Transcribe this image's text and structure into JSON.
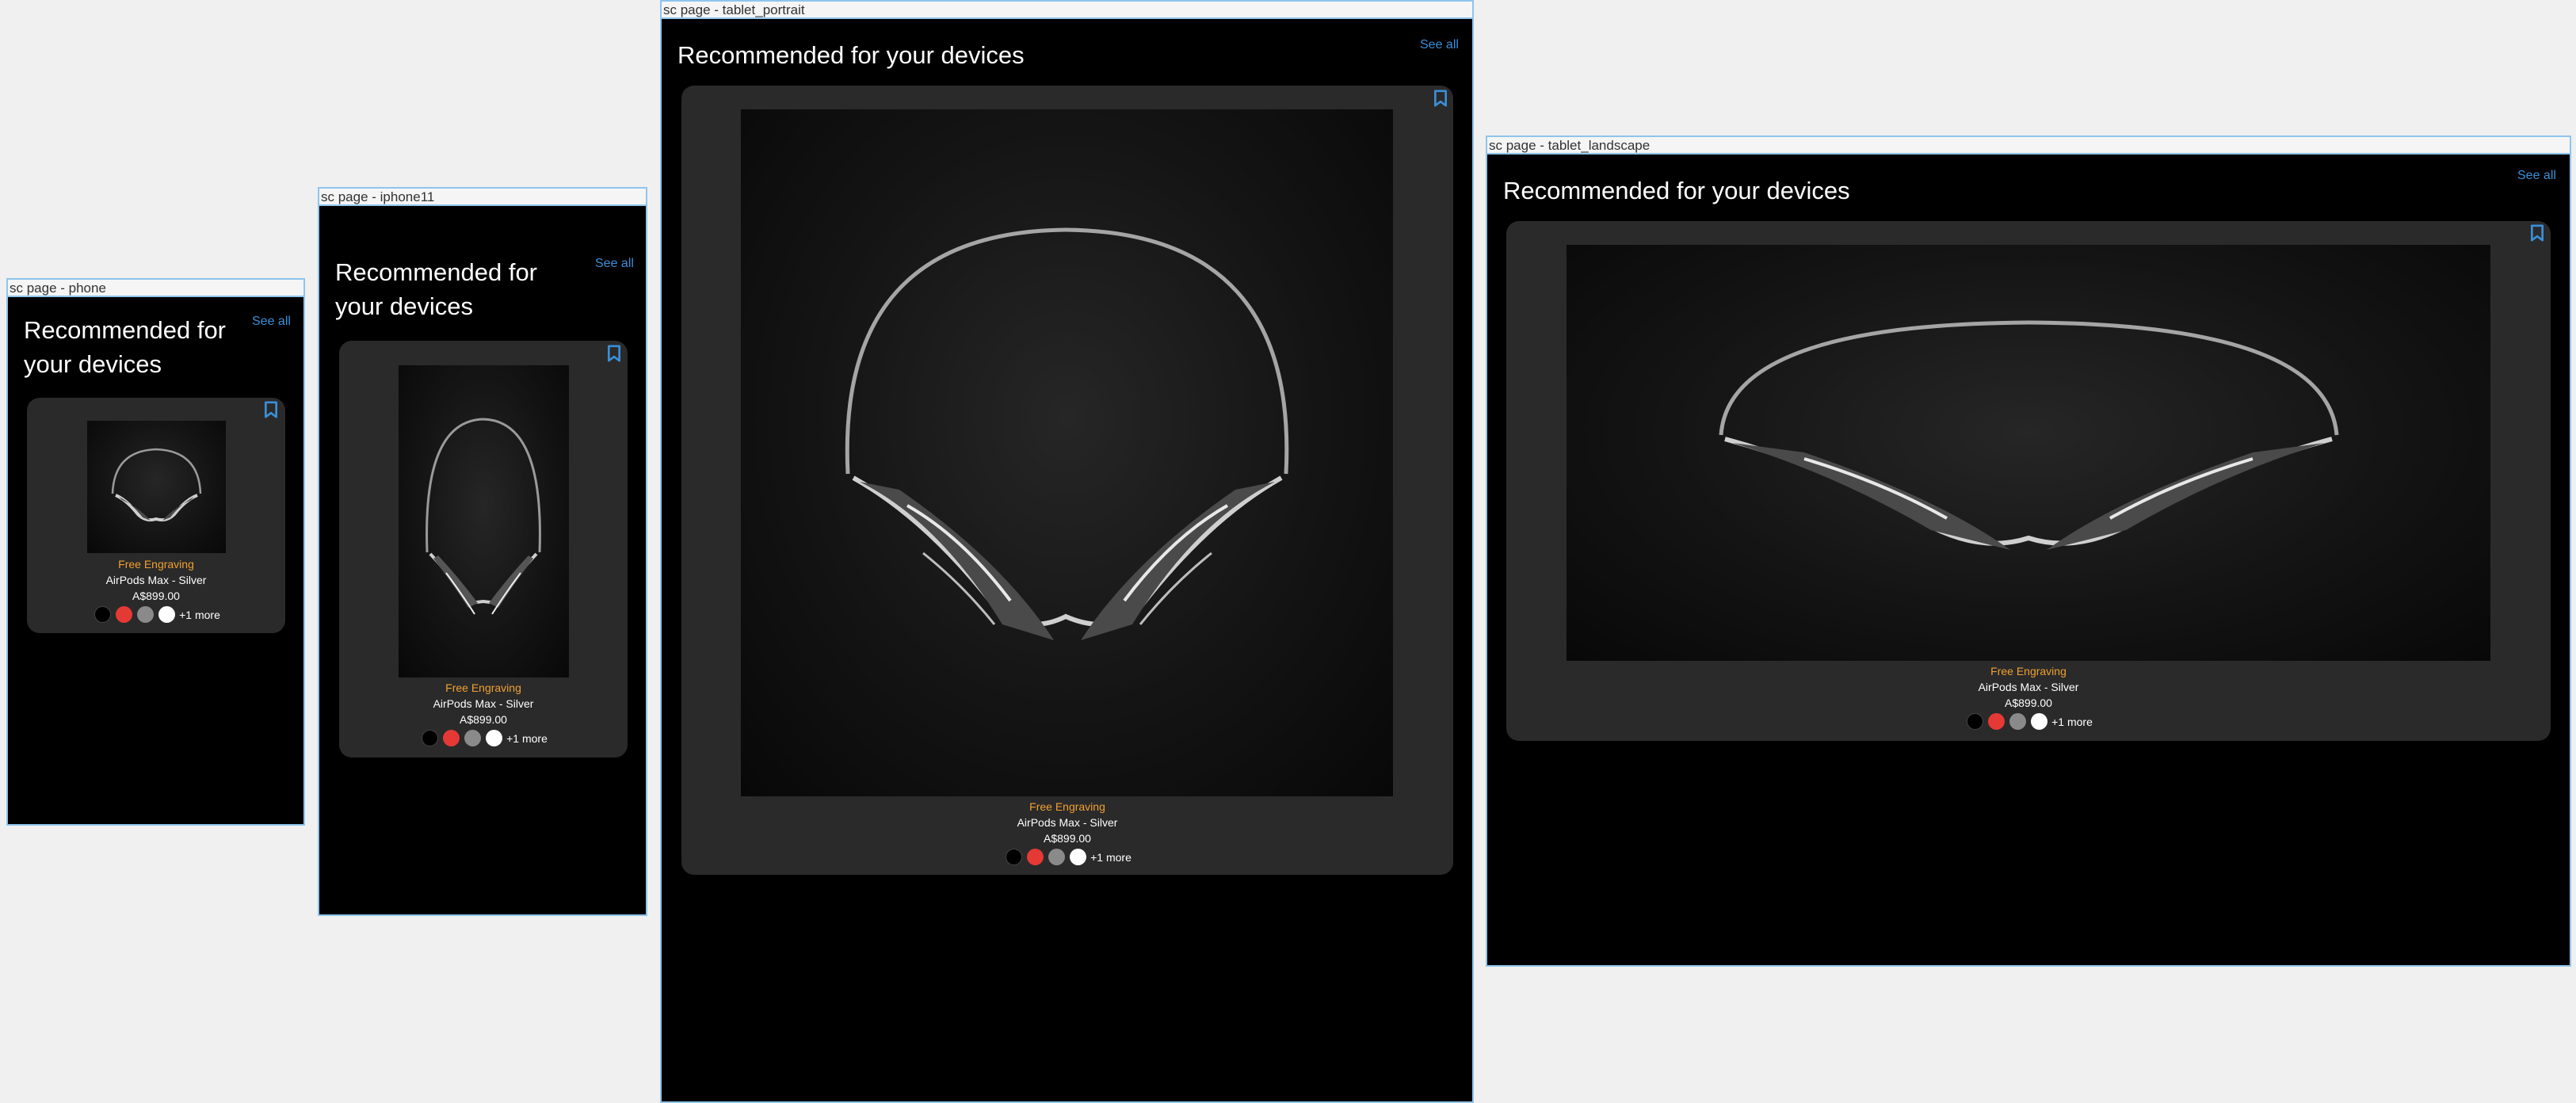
{
  "frames": {
    "phone": {
      "label": "sc page - phone"
    },
    "iphone11": {
      "label": "sc page - iphone11"
    },
    "tablet_portrait": {
      "label": "sc page - tablet_portrait"
    },
    "tablet_landscape": {
      "label": "sc page - tablet_landscape"
    }
  },
  "section": {
    "title": "Recommended for your devices",
    "see_all_label": "See all"
  },
  "product": {
    "promo": "Free Engraving",
    "name": "AirPods Max - Silver",
    "price": "A$899.00",
    "more_colors": "+1 more",
    "swatch_colors": [
      "#000000",
      "#e53935",
      "#8a8a8a",
      "#ffffff"
    ],
    "image_icon": "headphones-image",
    "bookmark_icon": "bookmark-icon"
  },
  "colors": {
    "accent": "#3a8fd8",
    "promo": "#f0a030",
    "card": "#2a2a2a",
    "background": "#000000"
  }
}
